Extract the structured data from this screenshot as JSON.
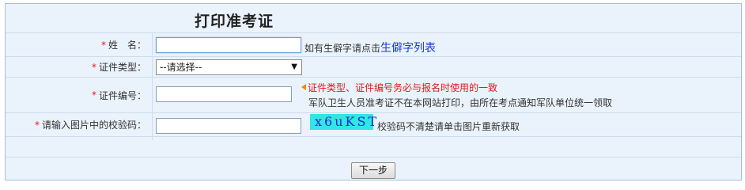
{
  "page": {
    "title": "打印准考证"
  },
  "form": {
    "name": {
      "required_mark": "*",
      "label": "姓　名：",
      "value": "",
      "hint": "如有生僻字请点击",
      "link": "生僻字列表"
    },
    "id_type": {
      "required_mark": "*",
      "label": "证件类型：",
      "selected": "--请选择--"
    },
    "id_number": {
      "required_mark": "*",
      "label": "证件编号：",
      "value": "",
      "warning": "证件类型、证件编号务必与报名时使用的一致",
      "note": "军队卫生人员准考证不在本网站打印，由所在考点通知军队单位统一领取"
    },
    "captcha": {
      "required_mark": "*",
      "label": "请输入图片中的校验码：",
      "value": "",
      "code": "x6uKST",
      "hint": "校验码不清楚请单击图片重新获取"
    }
  },
  "actions": {
    "next_label": "下一步"
  },
  "colors": {
    "background": "#eaf2fb",
    "required": "#e01a1a",
    "link": "#1a3ccf",
    "captcha_bg": "#33e5e5"
  }
}
